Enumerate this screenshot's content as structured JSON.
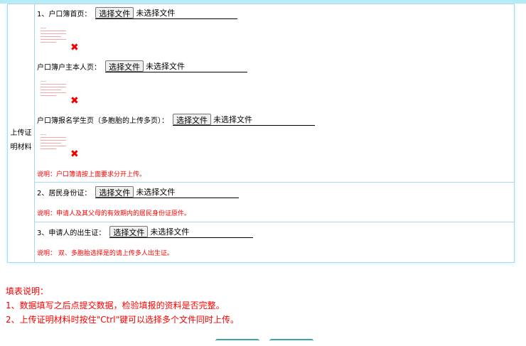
{
  "section_label": "上传证明材料",
  "file_button": "选择文件",
  "no_file": "未选择文件",
  "uploads": [
    {
      "label": "1、户口簿首页："
    },
    {
      "label": "户口簿户主本人页："
    },
    {
      "label": "户口簿报名学生页（多胞胎的上传多页）："
    }
  ],
  "note1": "说明：户口簿请按上面要求分开上传。",
  "id_card": {
    "label": "2、居民身份证：",
    "note": "说明：申请人及其父母的有效期内的居民身份证原件。"
  },
  "birth": {
    "label": "3、申请人的出生证：",
    "note": "说明： 双、多胞胎选择是的请上传多人出生证。"
  },
  "instructions": {
    "title": "填表说明：",
    "items": [
      "1、数据填写之后点提交数据，检验填报的资料是否完整。",
      "2、上传证明材料时按住\"Ctrl\"键可以选择多个文件同时上传。"
    ]
  },
  "remove_icon": "close-icon"
}
